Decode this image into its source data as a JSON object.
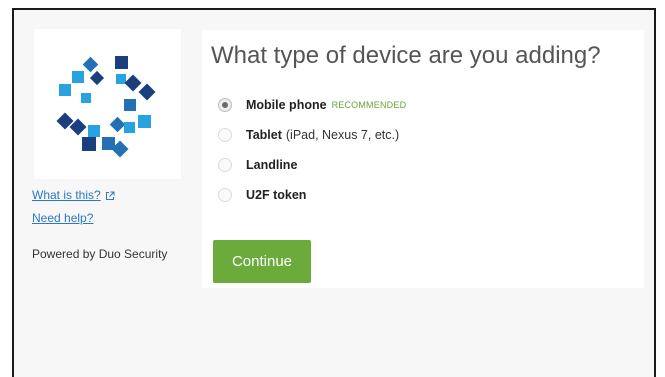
{
  "sidebar": {
    "what_is_this": "What is this?",
    "need_help": "Need help?",
    "powered_by": "Powered by Duo Security",
    "external_link_icon": "external-link-icon"
  },
  "form": {
    "title": "What type of device are you adding?",
    "options": [
      {
        "label": "Mobile phone",
        "note": "",
        "badge": "RECOMMENDED",
        "checked": true
      },
      {
        "label": "Tablet",
        "note": "(iPad, Nexus 7, etc.)",
        "badge": "",
        "checked": false
      },
      {
        "label": "Landline",
        "note": "",
        "badge": "",
        "checked": false
      },
      {
        "label": "U2F token",
        "note": "",
        "badge": "",
        "checked": false
      }
    ],
    "continue_label": "Continue"
  },
  "colors": {
    "accent_green": "#6bab3b",
    "badge_green": "#67a33b",
    "link_blue": "#2b78c4",
    "logo_navy": "#1b3f7e",
    "logo_blue": "#2470b5",
    "logo_cyan": "#27a4e0"
  }
}
